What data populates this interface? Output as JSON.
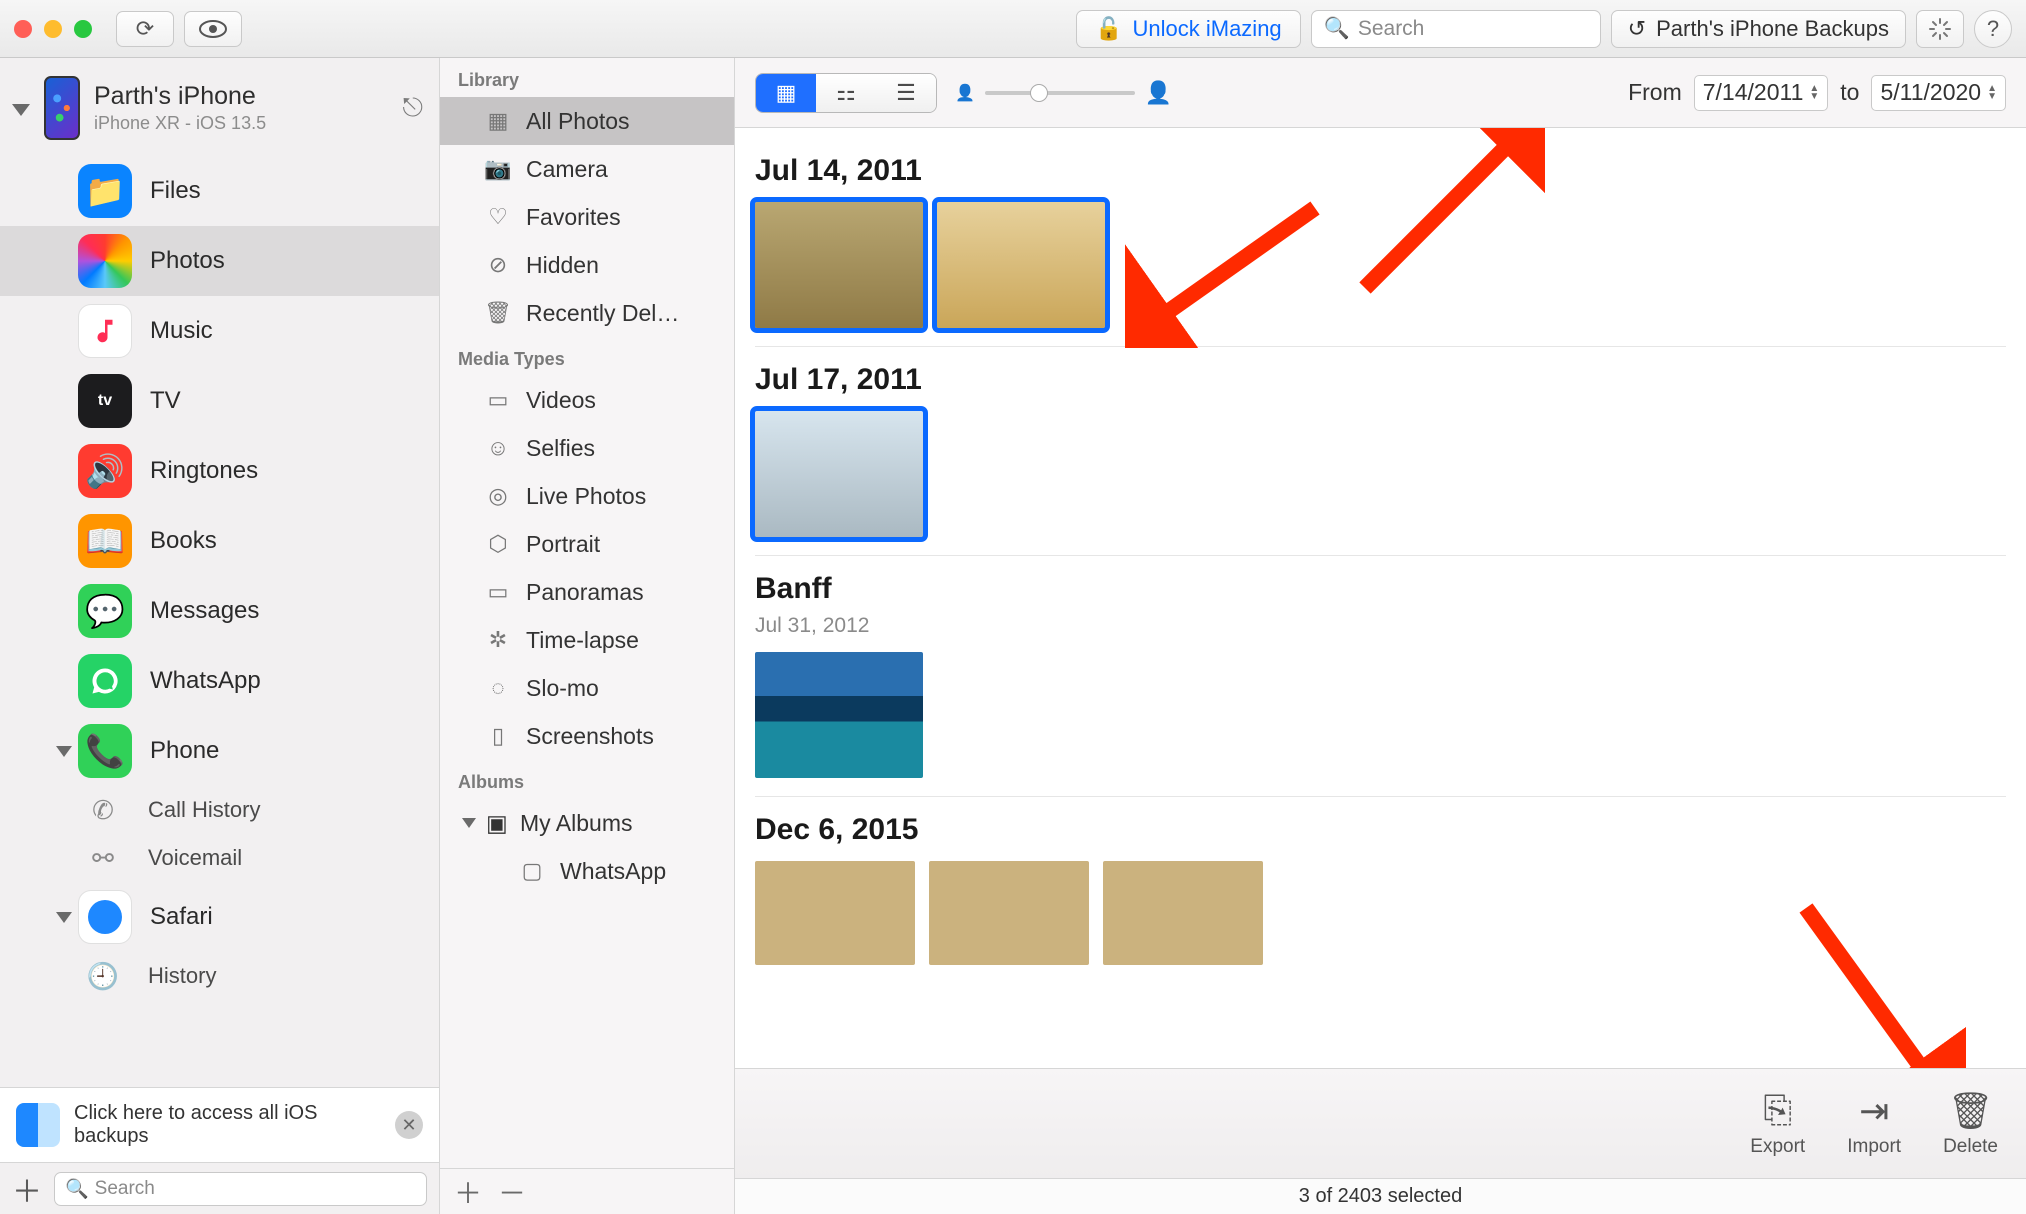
{
  "titlebar": {
    "unlock_label": "Unlock iMazing",
    "search_placeholder": "Search",
    "backups_label": "Parth's iPhone Backups"
  },
  "device": {
    "name": "Parth's iPhone",
    "subtitle": "iPhone XR - iOS 13.5"
  },
  "left_nav": {
    "items": [
      {
        "label": "Files"
      },
      {
        "label": "Photos"
      },
      {
        "label": "Music"
      },
      {
        "label": "TV"
      },
      {
        "label": "Ringtones"
      },
      {
        "label": "Books"
      },
      {
        "label": "Messages"
      },
      {
        "label": "WhatsApp"
      },
      {
        "label": "Phone"
      },
      {
        "label": "Safari"
      }
    ],
    "phone_children": [
      {
        "label": "Call History"
      },
      {
        "label": "Voicemail"
      }
    ],
    "safari_children": [
      {
        "label": "History"
      }
    ]
  },
  "left_banner": {
    "text": "Click here to access all iOS backups"
  },
  "left_footer": {
    "search_placeholder": "Search"
  },
  "library": {
    "section_library": "Library",
    "items_library": [
      {
        "label": "All Photos"
      },
      {
        "label": "Camera"
      },
      {
        "label": "Favorites"
      },
      {
        "label": "Hidden"
      },
      {
        "label": "Recently Del…"
      }
    ],
    "section_media": "Media Types",
    "items_media": [
      {
        "label": "Videos"
      },
      {
        "label": "Selfies"
      },
      {
        "label": "Live Photos"
      },
      {
        "label": "Portrait"
      },
      {
        "label": "Panoramas"
      },
      {
        "label": "Time-lapse"
      },
      {
        "label": "Slo-mo"
      },
      {
        "label": "Screenshots"
      }
    ],
    "section_albums": "Albums",
    "my_albums": "My Albums",
    "album_children": [
      {
        "label": "WhatsApp"
      }
    ]
  },
  "main_toolbar": {
    "from_label": "From",
    "to_label": "to",
    "date_from": "7/14/2011",
    "date_to": "5/11/2020"
  },
  "sections": [
    {
      "title": "Jul 14, 2011",
      "count": 2,
      "selected": [
        0,
        1
      ]
    },
    {
      "title": "Jul 17, 2011",
      "count": 1,
      "selected": [
        0
      ]
    },
    {
      "title": "Banff",
      "subtitle": "Jul 31, 2012",
      "count": 1,
      "selected": []
    },
    {
      "title": "Dec 6, 2015",
      "count": 3,
      "selected": []
    }
  ],
  "footer": {
    "export": "Export",
    "import": "Import",
    "delete": "Delete"
  },
  "status": "3 of 2403 selected"
}
